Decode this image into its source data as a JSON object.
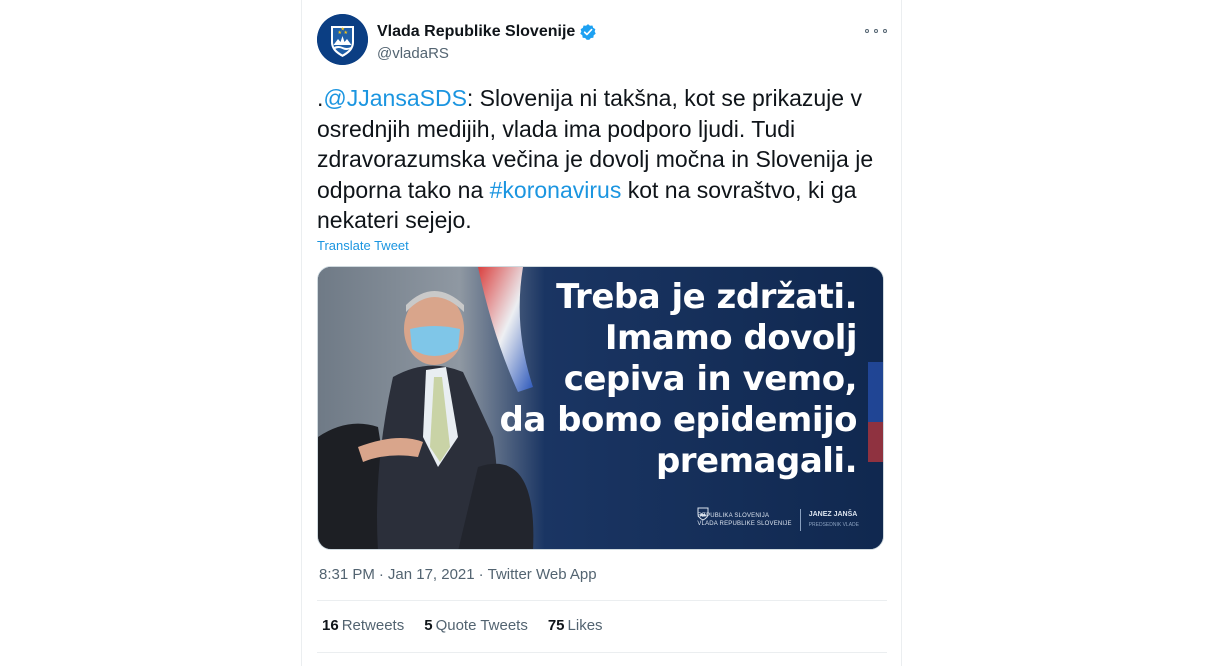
{
  "account": {
    "display_name": "Vlada Republike Slovenije",
    "handle": "@vladaRS",
    "verified_icon": "verified-badge-icon",
    "avatar_icon": "slovenian-coat-of-arms-icon"
  },
  "more_icon": "more-horizontal-icon",
  "tweet": {
    "prefix": ".",
    "mention": "@JJansaSDS",
    "text_part1": ": Slovenija ni takšna, kot se prikazuje v osrednjih medijih, vlada ima podporo ljudi. Tudi zdravorazumska večina je dovolj močna in Slovenija je odporna tako na ",
    "hashtag": "#koronavirus",
    "text_part2": " kot na sovraštvo, ki ga nekateri sejejo."
  },
  "translate_label": "Translate Tweet",
  "media": {
    "lines": [
      "Treba je zdržati.",
      "Imamo dovolj",
      "cepiva in vemo,",
      "da bomo epidemijo",
      "premagali."
    ],
    "footer_left_line1": "REPUBLIKA SLOVENIJA",
    "footer_left_line2": "VLADA REPUBLIKE SLOVENIJE",
    "footer_right_name": "JANEZ JANŠA",
    "footer_right_title": "PREDSEDNIK VLADE"
  },
  "meta": {
    "time": "8:31 PM",
    "sep": "·",
    "date": "Jan 17, 2021",
    "source": "Twitter Web App"
  },
  "stats": {
    "retweets_count": "16",
    "retweets_label": "Retweets",
    "quotes_count": "5",
    "quotes_label": "Quote Tweets",
    "likes_count": "75",
    "likes_label": "Likes"
  },
  "colors": {
    "link": "#1b95e0",
    "secondary_text": "#536471",
    "verified": "#1da1f2",
    "avatar_bg": "#0b3e83",
    "media_bg": "#10284f"
  }
}
